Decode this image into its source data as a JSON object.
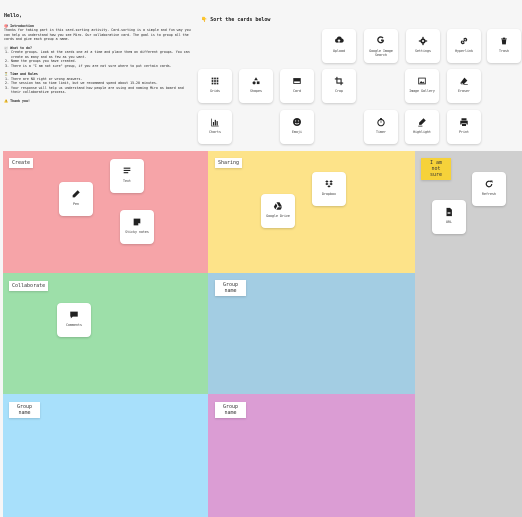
{
  "intro": {
    "hello": "Hello,",
    "sections": [
      {
        "icon": "🎯",
        "heading": "Introduction",
        "body": "Thanks for taking part in this card-sorting activity. Card-sorting is a simple and fun way you can help us understand how you see Miro. Our collaborative card. The goal is to group all the cards and give each group a name."
      },
      {
        "icon": "📰",
        "heading": "What to do?",
        "items": [
          "Create groups. Look at the cards one at a time and place them on different groups. You can create as many and as few as you want.",
          "Name the groups you have created.",
          "There is a \"I am not sure\" group, if you are not sure where to put certain cards."
        ]
      },
      {
        "icon": "⏳",
        "heading": "Time and Rules",
        "items": [
          "There are NO right or wrong answers.",
          "The session has no time limit, but we recommend spend about 15-20 minutes.",
          "Your response will help us understand how people are using and naming Miro as board and their collaborative process."
        ]
      },
      {
        "icon": "⚠️",
        "heading": "Thank you!"
      }
    ]
  },
  "sort_title": "👇 Sort the cards below",
  "palette": [
    {
      "label": "Upload",
      "icon": "upload-icon"
    },
    {
      "label": "Google Image Search",
      "icon": "google-icon"
    },
    {
      "label": "Settings",
      "icon": "gear-icon"
    },
    {
      "label": "Hyperlink",
      "icon": "link-icon"
    },
    {
      "label": "Trash",
      "icon": "trash-icon"
    },
    {
      "label": "Grids",
      "icon": "grid-icon"
    },
    {
      "label": "Shapes",
      "icon": "shapes-icon"
    },
    {
      "label": "Card",
      "icon": "card-icon"
    },
    {
      "label": "Crop",
      "icon": "crop-icon"
    },
    {
      "label": "Image Gallery",
      "icon": "image-icon"
    },
    {
      "label": "Eraser",
      "icon": "eraser-icon"
    },
    {
      "label": "Charts",
      "icon": "chart-icon"
    },
    {
      "label": "Emoji",
      "icon": "emoji-icon"
    },
    {
      "label": "Timer",
      "icon": "timer-icon"
    },
    {
      "label": "Highlight",
      "icon": "highlight-icon"
    },
    {
      "label": "Print",
      "icon": "print-icon"
    }
  ],
  "groups": [
    {
      "name": "Create",
      "color": "#f6a4a8",
      "cards": [
        {
          "label": "Text",
          "icon": "text-icon"
        },
        {
          "label": "Pen",
          "icon": "pen-icon"
        },
        {
          "label": "Sticky notes",
          "icon": "sticky-note-icon"
        }
      ]
    },
    {
      "name": "Sharing",
      "color": "#fde389",
      "cards": [
        {
          "label": "Dropbox",
          "icon": "dropbox-icon"
        },
        {
          "label": "Google Drive",
          "icon": "google-drive-icon"
        }
      ]
    },
    {
      "name": "I am not sure",
      "color": "#cfcfcf",
      "cards": [
        {
          "label": "Refresh",
          "icon": "refresh-icon"
        },
        {
          "label": "URL",
          "icon": "file-icon"
        }
      ]
    },
    {
      "name": "Collaborate",
      "color": "#9ddfa9",
      "cards": [
        {
          "label": "Comments",
          "icon": "comment-icon"
        }
      ]
    },
    {
      "name": "Group name",
      "color": "#a3cde3",
      "cards": []
    },
    {
      "name": "Group name",
      "color": "#a8e0fb",
      "cards": []
    },
    {
      "name": "Group name",
      "color": "#db9dd4",
      "cards": []
    }
  ]
}
